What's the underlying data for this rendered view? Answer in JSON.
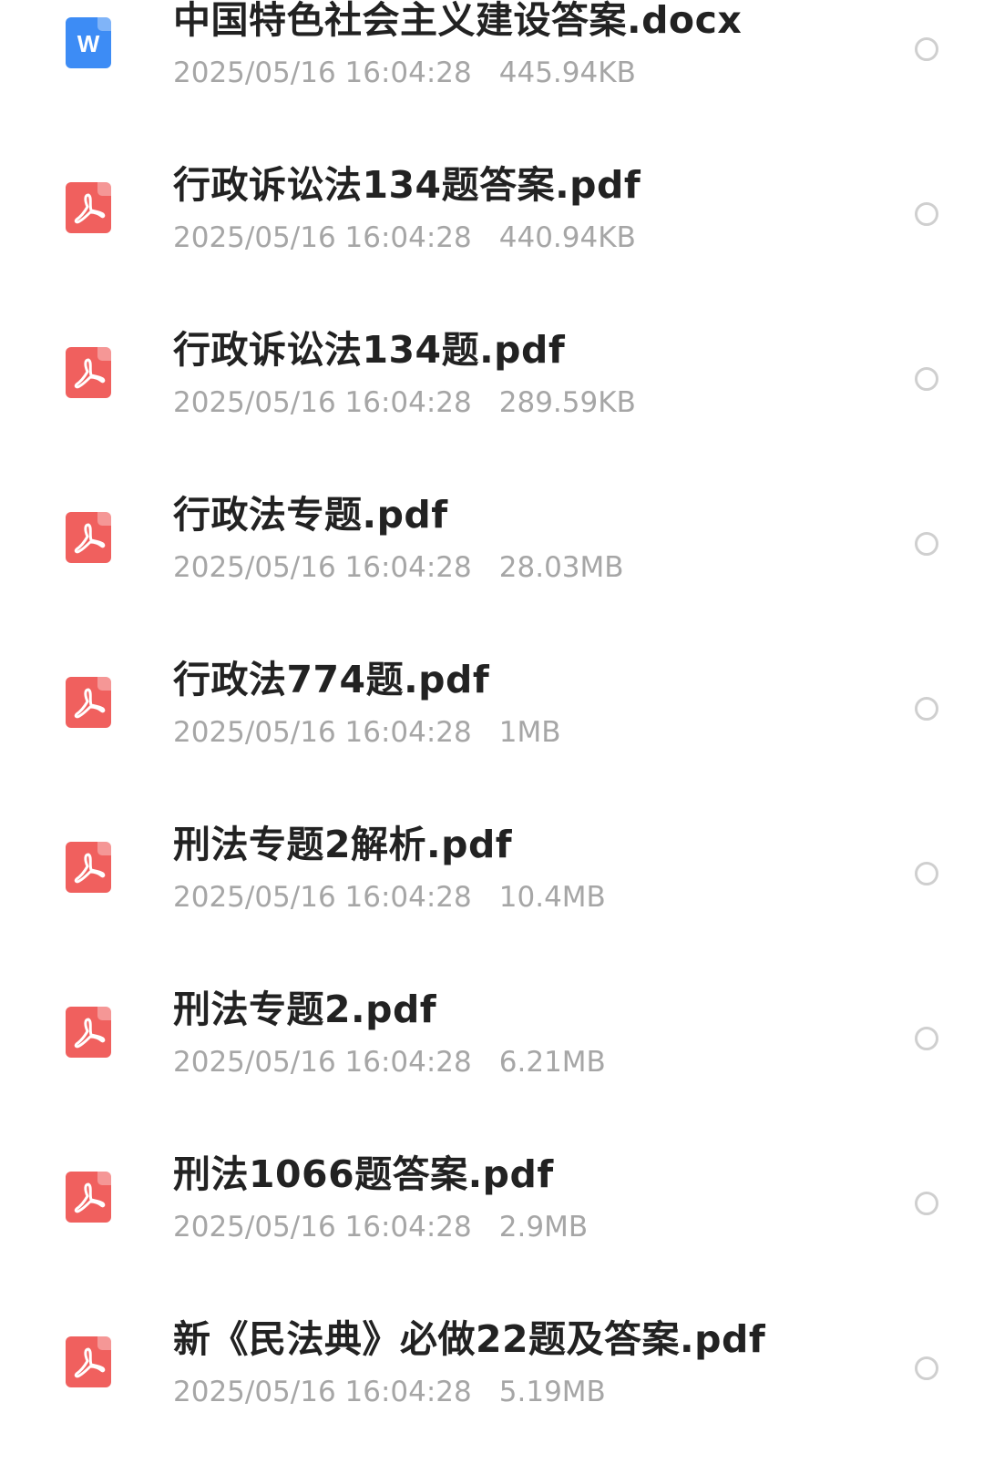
{
  "files": [
    {
      "name": "中国特色社会主义建设答案.docx",
      "date": "2025/05/16 16:04:28",
      "size": "445.94KB",
      "type": "docx",
      "icon": "word-doc-icon",
      "icon_letter": "W"
    },
    {
      "name": "行政诉讼法134题答案.pdf",
      "date": "2025/05/16 16:04:28",
      "size": "440.94KB",
      "type": "pdf",
      "icon": "pdf-icon"
    },
    {
      "name": "行政诉讼法134题.pdf",
      "date": "2025/05/16 16:04:28",
      "size": "289.59KB",
      "type": "pdf",
      "icon": "pdf-icon"
    },
    {
      "name": "行政法专题.pdf",
      "date": "2025/05/16 16:04:28",
      "size": "28.03MB",
      "type": "pdf",
      "icon": "pdf-icon"
    },
    {
      "name": "行政法774题.pdf",
      "date": "2025/05/16 16:04:28",
      "size": "1MB",
      "type": "pdf",
      "icon": "pdf-icon"
    },
    {
      "name": "刑法专题2解析.pdf",
      "date": "2025/05/16 16:04:28",
      "size": "10.4MB",
      "type": "pdf",
      "icon": "pdf-icon"
    },
    {
      "name": "刑法专题2.pdf",
      "date": "2025/05/16 16:04:28",
      "size": "6.21MB",
      "type": "pdf",
      "icon": "pdf-icon"
    },
    {
      "name": "刑法1066题答案.pdf",
      "date": "2025/05/16 16:04:28",
      "size": "2.9MB",
      "type": "pdf",
      "icon": "pdf-icon"
    },
    {
      "name": "新《民法典》必做22题及答案.pdf",
      "date": "2025/05/16 16:04:28",
      "size": "5.19MB",
      "type": "pdf",
      "icon": "pdf-icon"
    }
  ],
  "colors": {
    "pdf_icon": "#f0605e",
    "docx_icon": "#3d8cf5",
    "name_text": "#222222",
    "meta_text": "#a6a6a6",
    "radio_border": "#cfcfcf"
  }
}
